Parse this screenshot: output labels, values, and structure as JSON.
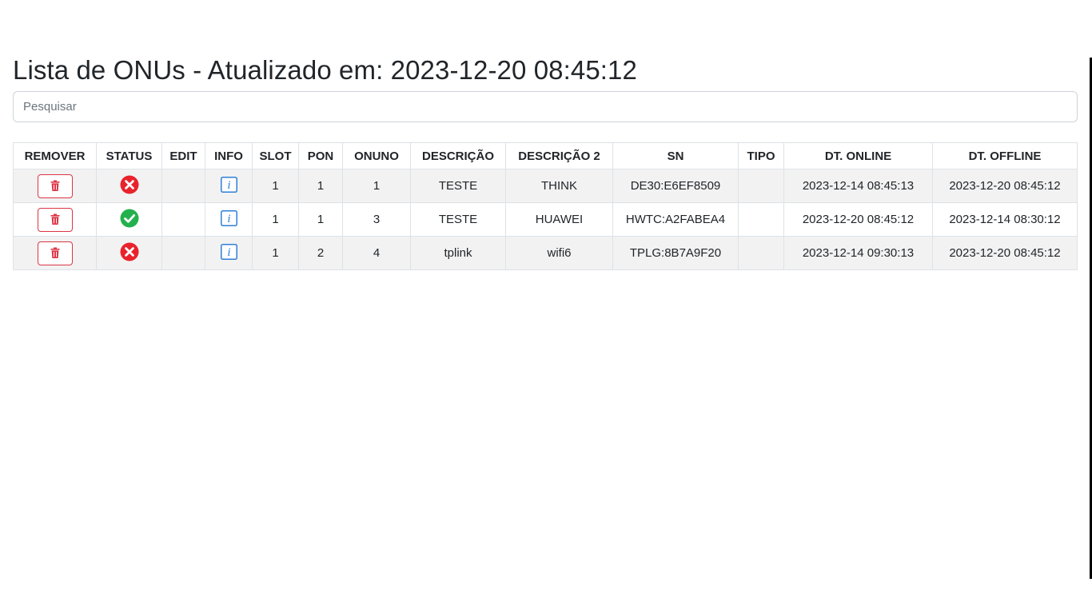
{
  "page": {
    "title": "Lista de ONUs - Atualizado em: 2023-12-20 08:45:12",
    "search_placeholder": "Pesquisar",
    "search_value": ""
  },
  "colors": {
    "danger": "#dc3545",
    "success": "#22b14c",
    "error": "#e8232c",
    "info": "#2f7fd8"
  },
  "table": {
    "headers": [
      "REMOVER",
      "STATUS",
      "EDIT",
      "INFO",
      "SLOT",
      "PON",
      "ONUNO",
      "DESCRIÇÃO",
      "DESCRIÇÃO 2",
      "SN",
      "TIPO",
      "DT. ONLINE",
      "DT. OFFLINE"
    ],
    "rows": [
      {
        "status_icon": "x-circle-icon",
        "info_icon": "info-icon",
        "edit": "",
        "slot": "1",
        "pon": "1",
        "onuno": "1",
        "descricao": "TESTE",
        "descricao2": "THINK",
        "sn": "DE30:E6EF8509",
        "tipo": "",
        "dt_online": "2023-12-14 08:45:13",
        "dt_offline": "2023-12-20 08:45:12"
      },
      {
        "status_icon": "check-circle-icon",
        "info_icon": "info-icon",
        "edit": "",
        "slot": "1",
        "pon": "1",
        "onuno": "3",
        "descricao": "TESTE",
        "descricao2": "HUAWEI",
        "sn": "HWTC:A2FABEA4",
        "tipo": "",
        "dt_online": "2023-12-20 08:45:12",
        "dt_offline": "2023-12-14 08:30:12"
      },
      {
        "status_icon": "x-circle-icon",
        "info_icon": "info-icon",
        "edit": "",
        "slot": "1",
        "pon": "2",
        "onuno": "4",
        "descricao": "tplink",
        "descricao2": "wifi6",
        "sn": "TPLG:8B7A9F20",
        "tipo": "",
        "dt_online": "2023-12-14 09:30:13",
        "dt_offline": "2023-12-20 08:45:12"
      }
    ]
  }
}
